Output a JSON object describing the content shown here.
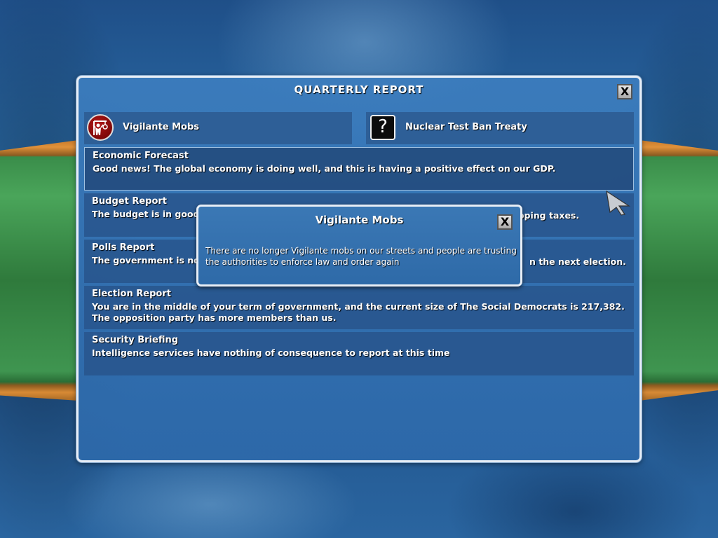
{
  "panel": {
    "title": "QUARTERLY REPORT",
    "close_label": "X"
  },
  "topics": {
    "left": {
      "label": "Vigilante Mobs",
      "icon": "vigilante-mob-icon"
    },
    "right": {
      "label": "Nuclear Test Ban Treaty",
      "icon": "question-mark-icon",
      "glyph": "?"
    }
  },
  "reports": [
    {
      "title": "Economic Forecast",
      "body": "Good news! The global economy is doing well, and this is having a positive effect on our GDP."
    },
    {
      "title": "Budget Report",
      "body": "The budget is in good s"
    },
    {
      "title": "Polls Report",
      "body": "The government is not"
    },
    {
      "title": "Election Report",
      "body": "You are in the middle of your term of government, and the current size of The Social Democrats is 217,382. The opposition party has more members than us."
    },
    {
      "title": "Security Briefing",
      "body": "Intelligence services have nothing of consequence to report at this time"
    }
  ],
  "report_tails": {
    "budget": "opping taxes.",
    "polls": "n the next election."
  },
  "popup": {
    "title": "Vigilante Mobs",
    "close_label": "X",
    "body": "There are no longer Vigilante mobs on our streets and people are trusting the authorities to enforce law and order again"
  },
  "colors": {
    "panel_border": "#e8eef6",
    "panel_fill": "#3c7dbe",
    "row_fill": "#28558c",
    "flag_orange": "#e0913a",
    "flag_green": "#4aa55a"
  }
}
